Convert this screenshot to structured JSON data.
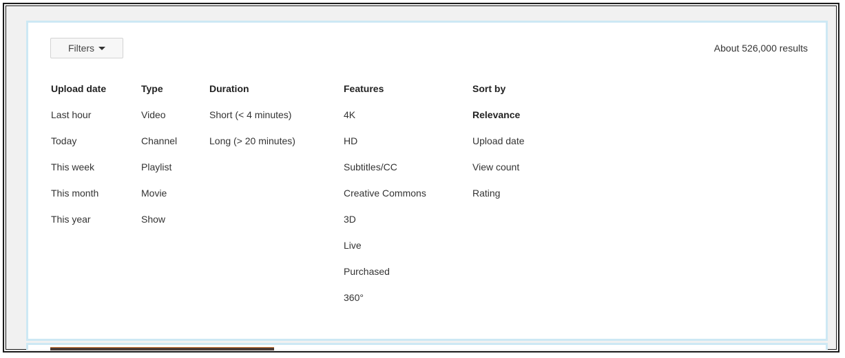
{
  "filters_button": {
    "label": "Filters",
    "icon": "caret-down-icon"
  },
  "results_count": "About 526,000 results",
  "filter_groups": [
    {
      "heading": "Upload date",
      "items": [
        "Last hour",
        "Today",
        "This week",
        "This month",
        "This year"
      ]
    },
    {
      "heading": "Type",
      "items": [
        "Video",
        "Channel",
        "Playlist",
        "Movie",
        "Show"
      ]
    },
    {
      "heading": "Duration",
      "items": [
        "Short (< 4 minutes)",
        "Long (> 20 minutes)"
      ]
    },
    {
      "heading": "Features",
      "items": [
        "4K",
        "HD",
        "Subtitles/CC",
        "Creative Commons",
        "3D",
        "Live",
        "Purchased",
        "360°"
      ]
    },
    {
      "heading": "Sort by",
      "items": [
        "Relevance",
        "Upload date",
        "View count",
        "Rating"
      ],
      "selected": "Relevance"
    }
  ],
  "colors": {
    "panel_border": "#cde8f4",
    "background": "#f1f1f1"
  }
}
